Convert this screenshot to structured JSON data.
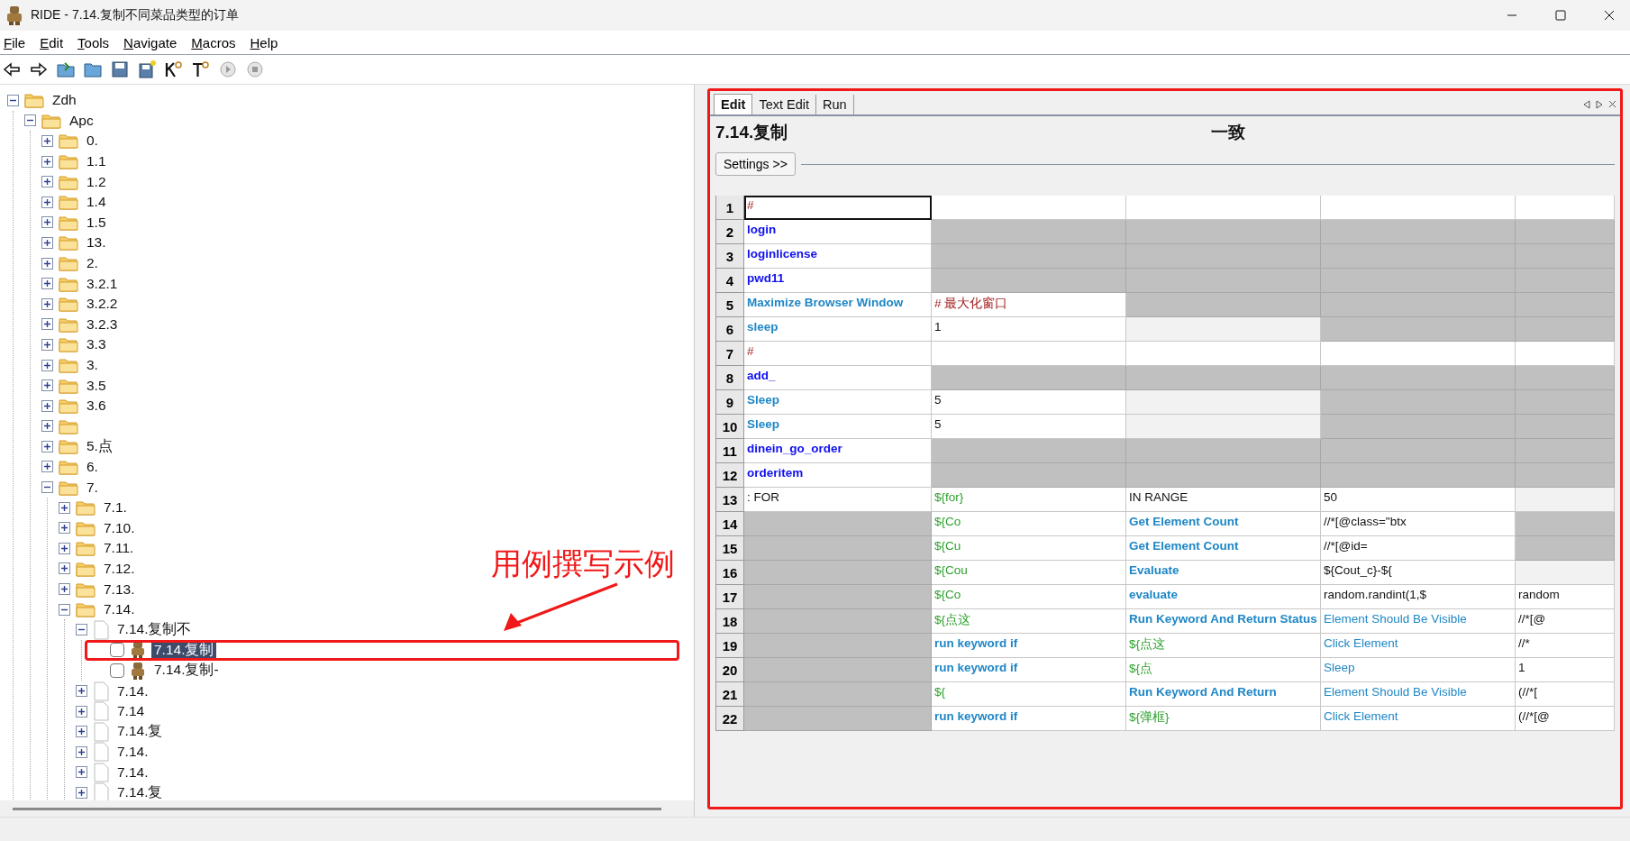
{
  "window": {
    "title": "RIDE - 7.14.复制不同菜品类型的订单"
  },
  "menu": [
    "File",
    "Edit",
    "Tools",
    "Navigate",
    "Macros",
    "Help"
  ],
  "tree": [
    {
      "kind": "folder",
      "label": "Zdh",
      "expanded": true,
      "selected": false,
      "children": [
        {
          "kind": "folder",
          "label": "Apc",
          "expanded": true,
          "selected": false,
          "children": [
            {
              "kind": "folder",
              "label": "0.",
              "expanded": false,
              "selected": false
            },
            {
              "kind": "folder",
              "label": "1.1",
              "expanded": false,
              "selected": false
            },
            {
              "kind": "folder",
              "label": "1.2",
              "expanded": false,
              "selected": false
            },
            {
              "kind": "folder",
              "label": "1.4",
              "expanded": false,
              "selected": false
            },
            {
              "kind": "folder",
              "label": "1.5",
              "expanded": false,
              "selected": false
            },
            {
              "kind": "folder",
              "label": "13.",
              "expanded": false,
              "selected": false
            },
            {
              "kind": "folder",
              "label": "2.",
              "expanded": false,
              "selected": false
            },
            {
              "kind": "folder",
              "label": "3.2.1",
              "expanded": false,
              "selected": false
            },
            {
              "kind": "folder",
              "label": "3.2.2",
              "expanded": false,
              "selected": false
            },
            {
              "kind": "folder",
              "label": "3.2.3",
              "expanded": false,
              "selected": false
            },
            {
              "kind": "folder",
              "label": "3.3",
              "expanded": false,
              "selected": false
            },
            {
              "kind": "folder",
              "label": "3.",
              "expanded": false,
              "selected": false
            },
            {
              "kind": "folder",
              "label": "3.5",
              "expanded": false,
              "selected": false
            },
            {
              "kind": "folder",
              "label": "3.6",
              "expanded": false,
              "selected": false
            },
            {
              "kind": "folder",
              "expanded": false,
              "selected": false
            },
            {
              "kind": "folder",
              "label": "5.点",
              "expanded": false,
              "selected": false
            },
            {
              "kind": "folder",
              "label": "6.",
              "expanded": false,
              "selected": false
            },
            {
              "kind": "folder",
              "label": "7.",
              "expanded": true,
              "selected": false,
              "children": [
                {
                  "kind": "folder",
                  "label": "7.1.",
                  "expanded": false,
                  "selected": false
                },
                {
                  "kind": "folder",
                  "label": "7.10.",
                  "expanded": false,
                  "selected": false
                },
                {
                  "kind": "folder",
                  "label": "7.11.",
                  "expanded": false,
                  "selected": false
                },
                {
                  "kind": "folder",
                  "label": "7.12.",
                  "expanded": false,
                  "selected": false
                },
                {
                  "kind": "folder",
                  "label": "7.13.",
                  "expanded": false,
                  "selected": false
                },
                {
                  "kind": "folder",
                  "label": "7.14.",
                  "expanded": true,
                  "selected": false,
                  "children": [
                    {
                      "kind": "file",
                      "label": "7.14.复制不",
                      "expanded": true,
                      "selected": false,
                      "children": [
                        {
                          "kind": "test",
                          "label": "7.14.复制",
                          "checked": false,
                          "selected": true
                        },
                        {
                          "kind": "test",
                          "label": "7.14.复制-",
                          "checked": false,
                          "selected": false
                        }
                      ]
                    },
                    {
                      "kind": "file",
                      "label": "7.14.",
                      "expanded": false,
                      "selected": false
                    },
                    {
                      "kind": "file",
                      "label": "7.14",
                      "expanded": false,
                      "selected": false
                    },
                    {
                      "kind": "file",
                      "label": "7.14.复",
                      "expanded": false,
                      "selected": false
                    },
                    {
                      "kind": "file",
                      "label": "7.14.",
                      "expanded": false,
                      "selected": false
                    },
                    {
                      "kind": "file",
                      "label": "7.14.",
                      "expanded": false,
                      "selected": false
                    },
                    {
                      "kind": "file",
                      "label": "7.14.复",
                      "expanded": false,
                      "selected": false
                    }
                  ]
                }
              ]
            }
          ]
        }
      ]
    }
  ],
  "annotation": {
    "text": "用例撰写示例"
  },
  "editor": {
    "tabs": [
      {
        "label": "Edit",
        "selected": true
      },
      {
        "label": "Text Edit",
        "selected": false
      },
      {
        "label": "Run",
        "selected": false
      }
    ],
    "heading": "7.14.复制",
    "heading_end": "一致",
    "settings_button": "Settings >>",
    "rows": [
      {
        "number": "1",
        "selected": true,
        "cells": [
          {
            "kind": "comment",
            "text": "#"
          },
          {
            "kind": "empty"
          },
          {
            "kind": "empty"
          },
          {
            "kind": "empty"
          },
          {
            "kind": "empty"
          }
        ]
      },
      {
        "number": "2",
        "selected": false,
        "cells": [
          {
            "kind": "user",
            "text": "login"
          },
          {
            "kind": "unused"
          },
          {
            "kind": "unused"
          },
          {
            "kind": "unused"
          },
          {
            "kind": "unused"
          }
        ]
      },
      {
        "number": "3",
        "selected": false,
        "cells": [
          {
            "kind": "user",
            "text": "loginlicense"
          },
          {
            "kind": "unused"
          },
          {
            "kind": "unused"
          },
          {
            "kind": "unused"
          },
          {
            "kind": "unused"
          }
        ]
      },
      {
        "number": "4",
        "selected": false,
        "cells": [
          {
            "kind": "user",
            "text": "pwd11"
          },
          {
            "kind": "unused"
          },
          {
            "kind": "unused"
          },
          {
            "kind": "unused"
          },
          {
            "kind": "unused"
          }
        ]
      },
      {
        "number": "5",
        "selected": false,
        "cells": [
          {
            "kind": "library",
            "text": "Maximize Browser Window"
          },
          {
            "kind": "comment",
            "text": "# 最大化窗口"
          },
          {
            "kind": "unused"
          },
          {
            "kind": "unused"
          },
          {
            "kind": "unused"
          }
        ]
      },
      {
        "number": "6",
        "selected": false,
        "cells": [
          {
            "kind": "library",
            "text": "sleep"
          },
          {
            "kind": "plain",
            "text": "1"
          },
          {
            "kind": "optional"
          },
          {
            "kind": "unused"
          },
          {
            "kind": "unused"
          }
        ]
      },
      {
        "number": "7",
        "selected": false,
        "cells": [
          {
            "kind": "comment",
            "text": "#"
          },
          {
            "kind": "empty"
          },
          {
            "kind": "empty"
          },
          {
            "kind": "empty"
          },
          {
            "kind": "empty"
          }
        ]
      },
      {
        "number": "8",
        "selected": false,
        "cells": [
          {
            "kind": "user",
            "text": "add_"
          },
          {
            "kind": "unused"
          },
          {
            "kind": "unused"
          },
          {
            "kind": "unused"
          },
          {
            "kind": "unused"
          }
        ]
      },
      {
        "number": "9",
        "selected": false,
        "cells": [
          {
            "kind": "library",
            "text": "Sleep"
          },
          {
            "kind": "plain",
            "text": "5"
          },
          {
            "kind": "optional"
          },
          {
            "kind": "unused"
          },
          {
            "kind": "unused"
          }
        ]
      },
      {
        "number": "10",
        "selected": false,
        "cells": [
          {
            "kind": "library",
            "text": "Sleep"
          },
          {
            "kind": "plain",
            "text": "5"
          },
          {
            "kind": "optional"
          },
          {
            "kind": "unused"
          },
          {
            "kind": "unused"
          }
        ]
      },
      {
        "number": "11",
        "selected": false,
        "cells": [
          {
            "kind": "user",
            "text": "dinein_go_order"
          },
          {
            "kind": "unused"
          },
          {
            "kind": "unused"
          },
          {
            "kind": "unused"
          },
          {
            "kind": "unused"
          }
        ]
      },
      {
        "number": "12",
        "selected": false,
        "cells": [
          {
            "kind": "user",
            "text": "orderitem"
          },
          {
            "kind": "unused"
          },
          {
            "kind": "unused"
          },
          {
            "kind": "unused"
          },
          {
            "kind": "unused"
          }
        ]
      },
      {
        "number": "13",
        "selected": false,
        "cells": [
          {
            "kind": "plain",
            "text": ": FOR"
          },
          {
            "kind": "variable",
            "text": "${for}"
          },
          {
            "kind": "plain",
            "text": "IN RANGE"
          },
          {
            "kind": "plain",
            "text": "50"
          },
          {
            "kind": "optional"
          }
        ]
      },
      {
        "number": "14",
        "selected": false,
        "cells": [
          {
            "kind": "unused"
          },
          {
            "kind": "variable",
            "text": "${Co"
          },
          {
            "kind": "library",
            "text": "Get Element Count"
          },
          {
            "kind": "plain",
            "text": "//*[@class=\"btx"
          },
          {
            "kind": "unused"
          }
        ]
      },
      {
        "number": "15",
        "selected": false,
        "cells": [
          {
            "kind": "unused"
          },
          {
            "kind": "variable",
            "text": "${Cu"
          },
          {
            "kind": "library",
            "text": "Get Element Count"
          },
          {
            "kind": "plain",
            "text": "//*[@id="
          },
          {
            "kind": "unused"
          }
        ]
      },
      {
        "number": "16",
        "selected": false,
        "cells": [
          {
            "kind": "unused"
          },
          {
            "kind": "variable",
            "text": "${Cou"
          },
          {
            "kind": "library",
            "text": "Evaluate"
          },
          {
            "kind": "plain",
            "text": "${Cout_c}-${"
          },
          {
            "kind": "optional"
          }
        ]
      },
      {
        "number": "17",
        "selected": false,
        "cells": [
          {
            "kind": "unused"
          },
          {
            "kind": "variable",
            "text": "${Co"
          },
          {
            "kind": "library",
            "text": "evaluate"
          },
          {
            "kind": "plain",
            "text": "random.randint(1,$"
          },
          {
            "kind": "plain",
            "text": "random"
          }
        ]
      },
      {
        "number": "18",
        "selected": false,
        "cells": [
          {
            "kind": "unused"
          },
          {
            "kind": "variable",
            "text": "${点这"
          },
          {
            "kind": "library",
            "text": "Run Keyword And Return Status"
          },
          {
            "kind": "argument",
            "text": "Element Should Be Visible"
          },
          {
            "kind": "plain",
            "text": "//*[@"
          }
        ]
      },
      {
        "number": "19",
        "selected": false,
        "cells": [
          {
            "kind": "unused"
          },
          {
            "kind": "library",
            "text": "run keyword if"
          },
          {
            "kind": "variable",
            "text": "${点这"
          },
          {
            "kind": "argument",
            "text": "Click Element"
          },
          {
            "kind": "plain",
            "text": "//*"
          }
        ]
      },
      {
        "number": "20",
        "selected": false,
        "cells": [
          {
            "kind": "unused"
          },
          {
            "kind": "library",
            "text": "run keyword if"
          },
          {
            "kind": "variable",
            "text": "${点"
          },
          {
            "kind": "argument",
            "text": "Sleep"
          },
          {
            "kind": "plain",
            "text": "1"
          }
        ]
      },
      {
        "number": "21",
        "selected": false,
        "cells": [
          {
            "kind": "unused"
          },
          {
            "kind": "variable",
            "text": "${"
          },
          {
            "kind": "library",
            "text": "Run Keyword And Return"
          },
          {
            "kind": "argument",
            "text": "Element Should Be Visible"
          },
          {
            "kind": "plain",
            "text": "(//*["
          }
        ]
      },
      {
        "number": "22",
        "selected": false,
        "cells": [
          {
            "kind": "unused"
          },
          {
            "kind": "library",
            "text": "run keyword if"
          },
          {
            "kind": "variable",
            "text": "${弹框}"
          },
          {
            "kind": "argument",
            "text": "Click Element"
          },
          {
            "kind": "plain",
            "text": "(//*[@"
          }
        ]
      }
    ]
  }
}
